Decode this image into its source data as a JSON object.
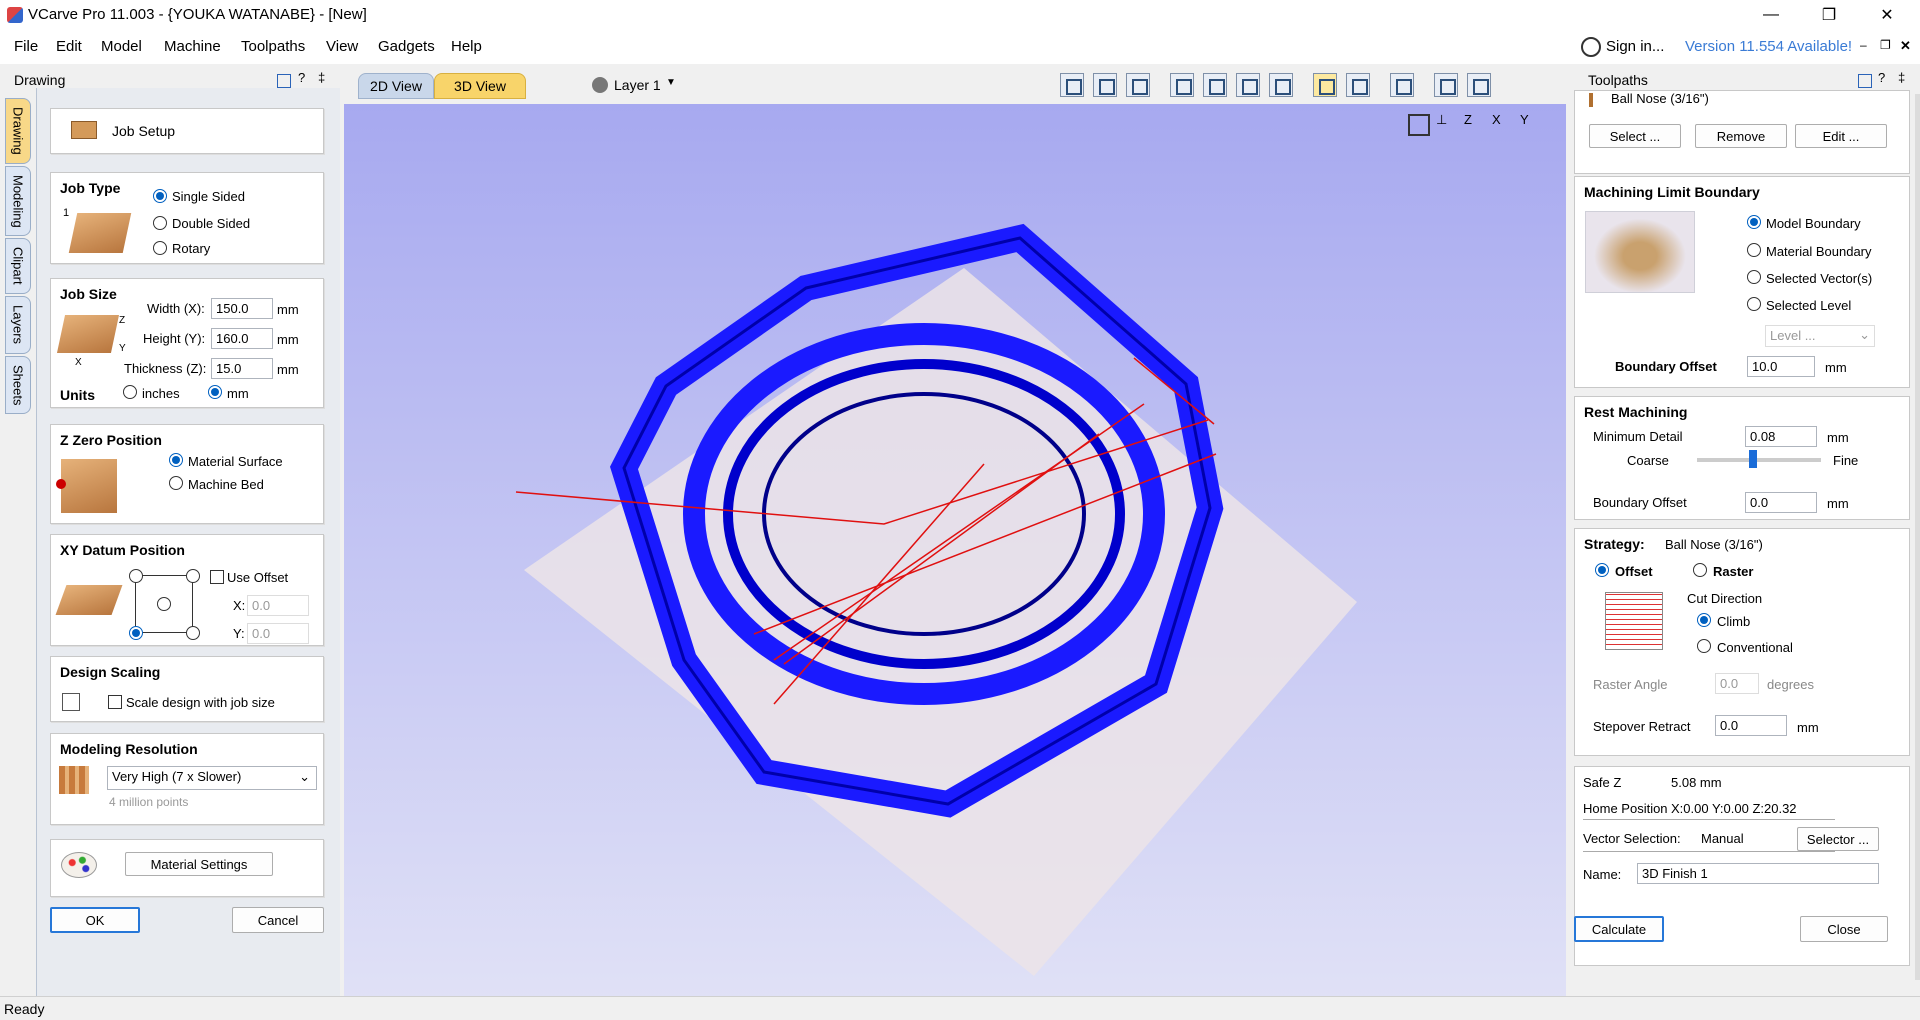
{
  "window": {
    "title": "VCarve Pro 11.003 - {YOUKA WATANABE} - [New]"
  },
  "menu": {
    "items": [
      "File",
      "Edit",
      "Model",
      "Machine",
      "Toolpaths",
      "View",
      "Gadgets",
      "Help"
    ],
    "sign_in": "Sign in...",
    "version": "Version 11.554 Available!"
  },
  "left_panel": {
    "header": "Drawing",
    "tabs": [
      "Drawing",
      "Modeling",
      "Clipart",
      "Layers",
      "Sheets"
    ],
    "job_setup": "Job Setup",
    "job_type": {
      "title": "Job Type",
      "options": [
        "Single Sided",
        "Double Sided",
        "Rotary"
      ],
      "selected": "Single Sided",
      "img_num": "1"
    },
    "job_size": {
      "title": "Job Size",
      "width_label": "Width (X):",
      "width": "150.0",
      "height_label": "Height (Y):",
      "height": "160.0",
      "thickness_label": "Thickness (Z):",
      "thickness": "15.0",
      "unit": "mm",
      "units_label": "Units",
      "inches": "inches",
      "mm": "mm",
      "axis_x": "X",
      "axis_y": "Y",
      "axis_z": "Z"
    },
    "z_zero": {
      "title": "Z Zero Position",
      "options": [
        "Material Surface",
        "Machine Bed"
      ],
      "selected": "Material Surface"
    },
    "xy_datum": {
      "title": "XY Datum Position",
      "use_offset": "Use Offset",
      "x_label": "X:",
      "x": "0.0",
      "y_label": "Y:",
      "y": "0.0"
    },
    "design_scaling": {
      "title": "Design Scaling",
      "checkbox": "Scale design with job size"
    },
    "modeling_resolution": {
      "title": "Modeling Resolution",
      "value": "Very High (7 x Slower)",
      "sub": "4 million points"
    },
    "material_settings": "Material Settings",
    "ok": "OK",
    "cancel": "Cancel"
  },
  "viewport": {
    "tabs": [
      "2D View",
      "3D View"
    ],
    "active_tab": "3D View",
    "layer": "Layer 1"
  },
  "right_panel": {
    "header": "Toolpaths",
    "tool_name": "Ball Nose (3/16\")",
    "select": "Select ...",
    "remove": "Remove",
    "edit": "Edit ...",
    "mlb": {
      "title": "Machining Limit Boundary",
      "options": [
        "Model Boundary",
        "Material Boundary",
        "Selected Vector(s)",
        "Selected Level"
      ],
      "selected": "Model Boundary",
      "level": "Level ...",
      "boundary_offset_label": "Boundary Offset",
      "boundary_offset": "10.0",
      "unit": "mm"
    },
    "rest": {
      "title": "Rest Machining",
      "min_detail_label": "Minimum Detail",
      "min_detail": "0.08",
      "coarse": "Coarse",
      "fine": "Fine",
      "slider_value": 0.45,
      "boundary_offset_label": "Boundary Offset",
      "boundary_offset": "0.0",
      "unit": "mm"
    },
    "strategy": {
      "title": "Strategy:",
      "tool": "Ball Nose (3/16\")",
      "offset": "Offset",
      "raster": "Raster",
      "cut_direction": "Cut Direction",
      "climb": "Climb",
      "conventional": "Conventional",
      "raster_angle_label": "Raster Angle",
      "raster_angle": "0.0",
      "degrees": "degrees",
      "stepover_retract_label": "Stepover Retract",
      "stepover_retract": "0.0",
      "unit": "mm"
    },
    "info": {
      "safe_z_label": "Safe Z",
      "safe_z": "5.08 mm",
      "home_label": "Home Position",
      "home": "X:0.00 Y:0.00 Z:20.32",
      "vector_sel_label": "Vector Selection:",
      "vector_sel": "Manual",
      "selector": "Selector ...",
      "name_label": "Name:",
      "name": "3D Finish 1"
    },
    "calculate": "Calculate",
    "close": "Close"
  },
  "status": {
    "text": "Ready"
  }
}
